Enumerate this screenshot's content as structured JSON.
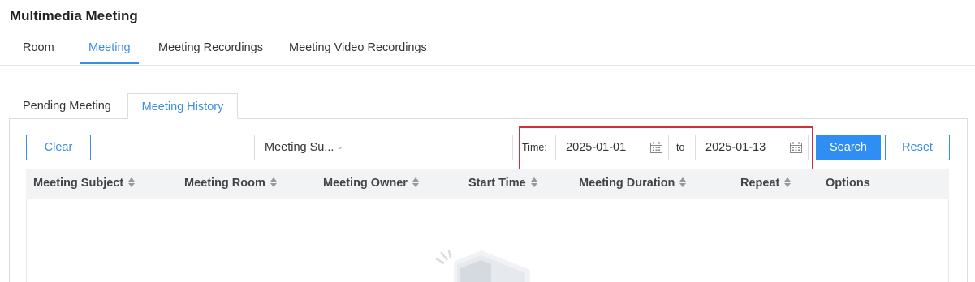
{
  "page": {
    "title": "Multimedia Meeting"
  },
  "top_tabs": [
    {
      "label": "Room",
      "active": false
    },
    {
      "label": "Meeting",
      "active": true
    },
    {
      "label": "Meeting Recordings",
      "active": false
    },
    {
      "label": "Meeting Video Recordings",
      "active": false
    }
  ],
  "sub_tabs": [
    {
      "label": "Pending Meeting",
      "active": false
    },
    {
      "label": "Meeting History",
      "active": true
    }
  ],
  "toolbar": {
    "clear_label": "Clear",
    "filter_select_value": "Meeting Su...",
    "filter_input_value": "",
    "time_label": "Time:",
    "date_from": "2025-01-01",
    "to_label": "to",
    "date_to": "2025-01-13",
    "search_label": "Search",
    "reset_label": "Reset"
  },
  "table": {
    "columns": [
      "Meeting Subject",
      "Meeting Room",
      "Meeting Owner",
      "Start Time",
      "Meeting Duration",
      "Repeat",
      "Options"
    ],
    "rows": []
  },
  "colors": {
    "accent": "#3a8de6",
    "primary_button": "#2f8ef3",
    "highlight_border": "#d32f3a",
    "table_header_bg": "#f2f3f5"
  },
  "icons": {
    "calendar": "calendar-icon",
    "sort": "sort-icon",
    "dropdown": "chevron-down-icon"
  }
}
